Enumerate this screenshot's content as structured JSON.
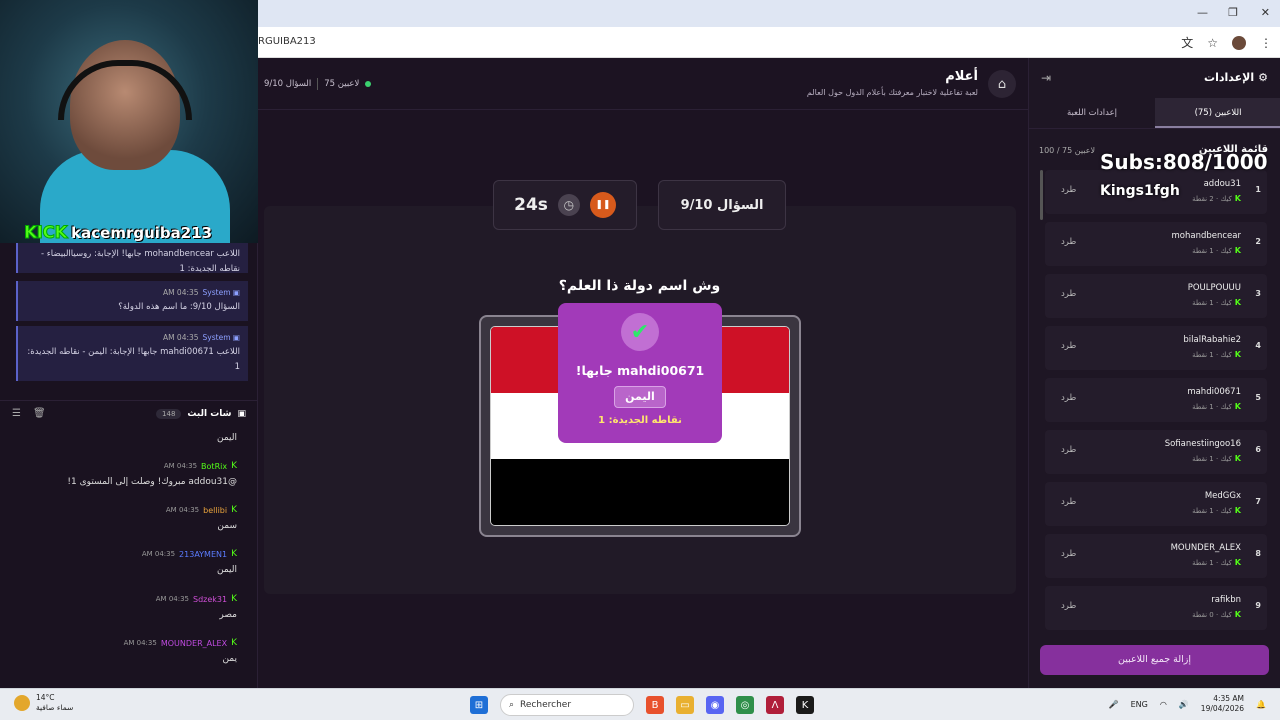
{
  "browser": {
    "url_fragment": "RGUIBA213",
    "controls": [
      "—",
      "❐",
      "✕"
    ]
  },
  "stream": {
    "kick_logo": "KICK",
    "streamer": "kacemrguiba213",
    "subs_goal": "Subs:808/1000",
    "subs_user": "Kings1fgh"
  },
  "system_messages": [
    {
      "sender": "",
      "time": "",
      "text": "اللاعب mohandbencear جابها! الإجابة: روسياالبيضاء - نقاطه الجديدة: 1"
    },
    {
      "sender": "System",
      "time": "AM 04:35",
      "text": "السؤال 9/10: ما اسم هذه الدولة؟"
    },
    {
      "sender": "System",
      "time": "AM 04:35",
      "text": "اللاعب mahdi00671 جابها! الإجابة: اليمن - نقاطه الجديدة: 1"
    }
  ],
  "chat": {
    "title": "شات البث",
    "count": "148",
    "messages": [
      {
        "user": "",
        "time": "",
        "color": "#ffffff",
        "text": "اليمن"
      },
      {
        "user": "BotRix",
        "time": "AM 04:35",
        "color": "#53fc18",
        "text": "@addou31 مبروك! وصلت إلى المستوى 1!"
      },
      {
        "user": "bellibi",
        "time": "AM 04:35",
        "color": "#e8a33c",
        "text": "سمن"
      },
      {
        "user": "213AYMEN1",
        "time": "AM 04:35",
        "color": "#5b7cff",
        "text": "اليمن"
      },
      {
        "user": "Sdzek31",
        "time": "AM 04:35",
        "color": "#d04fd8",
        "text": "مصر"
      },
      {
        "user": "MOUNDER_ALEX",
        "time": "AM 04:35",
        "color": "#c04be0",
        "text": "يمن"
      }
    ]
  },
  "game": {
    "title": "أعلام",
    "subtitle": "لعبة تفاعلية لاختبار معرفتك بأعلام الدول حول العالم",
    "players_online": "75 لاعبين",
    "question_counter": "السؤال 9/10",
    "timer": "24s",
    "question_card": "السؤال 9/10",
    "question": "وش اسم دولة ذا العلم؟",
    "flag_colors": [
      "#ce1126",
      "#ffffff",
      "#000000"
    ],
    "popup": {
      "title": "mahdi00671 جابها!",
      "answer": "اليمن",
      "points": "نقاطه الجديدة: 1"
    }
  },
  "settings": {
    "title": "الإعدادات",
    "tabs": [
      "اللاعبين (75)",
      "إعدادات اللعبة"
    ],
    "list_title": "قائمة اللاعبين",
    "list_count": "100 / 75 لاعبين",
    "kick_label": "طرد",
    "remove_all": "إزالة جميع اللاعبين",
    "players": [
      {
        "rank": "1",
        "name": "addou31",
        "sub": "كيك · 2 نقطة"
      },
      {
        "rank": "2",
        "name": "mohandbencear",
        "sub": "كيك · 1 نقطة"
      },
      {
        "rank": "3",
        "name": "POULPOUUU",
        "sub": "كيك · 1 نقطة"
      },
      {
        "rank": "4",
        "name": "bilalRabahie2",
        "sub": "كيك · 1 نقطة"
      },
      {
        "rank": "5",
        "name": "mahdi00671",
        "sub": "كيك · 1 نقطة"
      },
      {
        "rank": "6",
        "name": "Sofianestiingoo16",
        "sub": "كيك · 1 نقطة"
      },
      {
        "rank": "7",
        "name": "MedGGx",
        "sub": "كيك · 1 نقطة"
      },
      {
        "rank": "8",
        "name": "MOUNDER_ALEX",
        "sub": "كيك · 1 نقطة"
      },
      {
        "rank": "9",
        "name": "rafikbn",
        "sub": "كيك · 0 نقطة"
      }
    ]
  },
  "taskbar": {
    "temperature": "14°C",
    "weather": "سماء صافية",
    "search": "Rechercher",
    "language": "ENG",
    "time": "4:35 AM",
    "date": "19/04/2026"
  }
}
